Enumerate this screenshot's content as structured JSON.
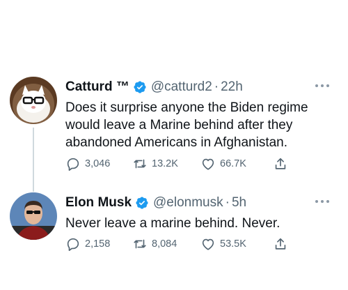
{
  "tweets": [
    {
      "name": "Catturd ™",
      "handle": "@catturd2",
      "separator": "·",
      "time": "22h",
      "text": "Does it surprise anyone the Biden regime would leave a Marine behind after they abandoned Americans in Afghanistan.",
      "replies": "3,046",
      "retweets": "13.2K",
      "likes": "66.7K"
    },
    {
      "name": "Elon Musk",
      "handle": "@elonmusk",
      "separator": "·",
      "time": "5h",
      "text": "Never leave a marine behind. Never.",
      "replies": "2,158",
      "retweets": "8,084",
      "likes": "53.5K"
    }
  ],
  "icons": {
    "verified": "verified-badge-icon",
    "more": "more-options-icon",
    "reply": "reply-icon",
    "retweet": "retweet-icon",
    "like": "like-icon",
    "share": "share-icon"
  },
  "colors": {
    "verified": "#1d9bf0",
    "text": "#0f1419",
    "secondary": "#536471",
    "connector": "#cfd9de"
  }
}
